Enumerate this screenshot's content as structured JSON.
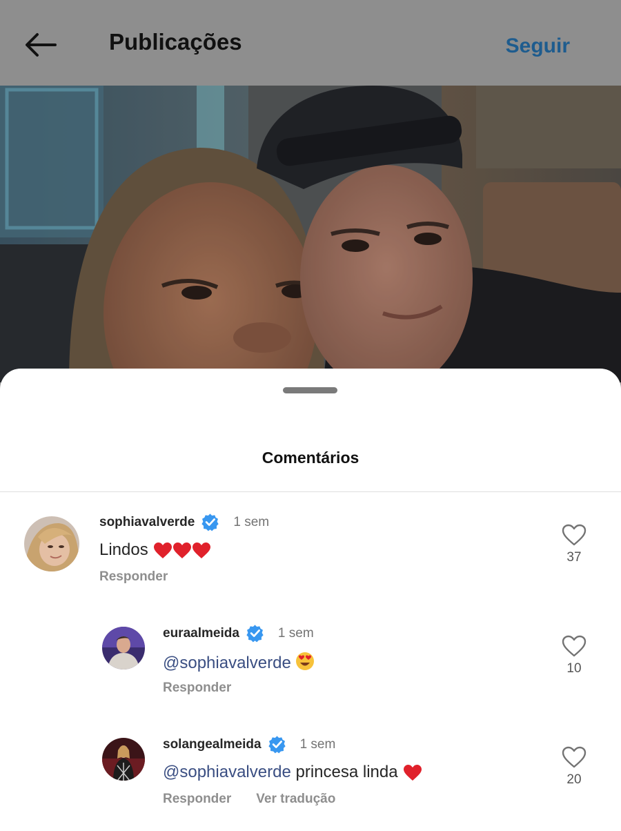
{
  "header": {
    "title": "Publicações",
    "follow_label": "Seguir",
    "back_icon": "arrow-left-icon"
  },
  "sheet": {
    "title": "Comentários"
  },
  "comments": [
    {
      "username": "sophiavalverde",
      "verified": true,
      "time": "1 sem",
      "text": "Lindos",
      "emoji": [
        "heart",
        "heart",
        "heart"
      ],
      "reply_label": "Responder",
      "likes": "37"
    },
    {
      "username": "euraalmeida",
      "verified": true,
      "time": "1 sem",
      "mention": "@sophiavalverde",
      "text": "",
      "emoji": [
        "heart-eyes-smiley"
      ],
      "reply_label": "Responder",
      "likes": "10"
    },
    {
      "username": "solangealmeida",
      "verified": true,
      "time": "1 sem",
      "mention": "@sophiavalverde",
      "text": "princesa linda",
      "emoji": [
        "heart"
      ],
      "reply_label": "Responder",
      "translate_label": "Ver tradução",
      "likes": "20"
    }
  ],
  "colors": {
    "dim_header": "#8e8e8e",
    "follow_text": "#1e5c8e",
    "verified_badge": "#3897f0",
    "mention_text": "#3a4e82",
    "heart_emoji": "#e0212b"
  }
}
